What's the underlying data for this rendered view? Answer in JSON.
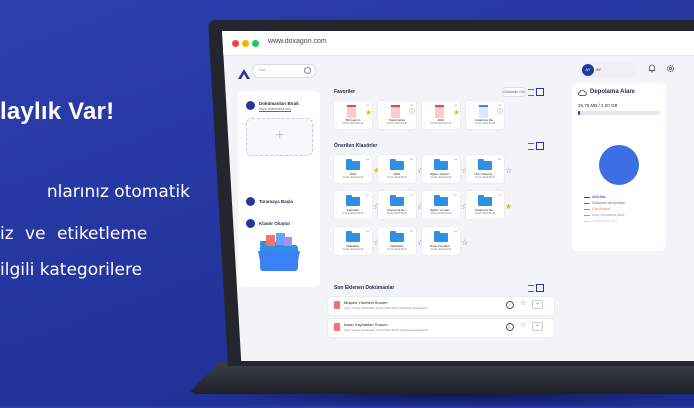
{
  "promo": {
    "title": "laylık Var!",
    "line1": "nlarınız otomatik",
    "line2": "iz ve etiketleme",
    "line3": "ilgili kategorilere"
  },
  "browser": {
    "url": "www.doxagon.com"
  },
  "header": {
    "search_placeholder": "Ara",
    "user_initials": "AY",
    "user_name": "AY"
  },
  "sidebar": {
    "doc_title": "Dokümanları Bırak",
    "doc_sub": "veya dokümana seç",
    "scan_label": "Taramaya Başla",
    "folder_label": "Klasör Oluştur"
  },
  "favorites": {
    "title": "Favoriler",
    "view_label": "Görüntüle Gör",
    "items": [
      {
        "name": "Bill Gurium",
        "date": "01.01.2023 09:32",
        "type": "pdf",
        "fav": true
      },
      {
        "name": "Nişan fatura",
        "date": "01.01.2023 09:32",
        "type": "pdf",
        "fav": false
      },
      {
        "name": "2021",
        "date": "01.01.2023 09:32",
        "type": "pdf",
        "fav": true
      },
      {
        "name": "Araştırma Ra...",
        "date": "01.01.2023 09:32",
        "type": "doc",
        "fav": false
      }
    ]
  },
  "suggested": {
    "title": "Önerilen Klasörler",
    "items": [
      {
        "name": "2021",
        "date": "01.01.2023 09:32",
        "fav": true
      },
      {
        "name": "2020",
        "date": "01.01.2023 09:32",
        "fav": false
      },
      {
        "name": "Eğitim Doküm...",
        "date": "01.01.2023 09:32",
        "fav": false
      },
      {
        "name": "Ürün Tasarım ...",
        "date": "01.01.2023 09:32",
        "fav": false
      },
      {
        "name": "Faturalar",
        "date": "01.01.2023 09:32",
        "fav": false
      },
      {
        "name": "Üzgeçmiş Do...",
        "date": "01.01.2023 09:32",
        "fav": false
      },
      {
        "name": "Eğitim ve Gelı...",
        "date": "01.01.2023 09:32",
        "fav": false
      },
      {
        "name": "Araştırma Ra...",
        "date": "01.01.2023 09:32",
        "fav": true
      },
      {
        "name": "Makaleler",
        "date": "01.01.2023 09:32",
        "fav": false
      },
      {
        "name": "Makaleler",
        "date": "01.01.2023 09:32",
        "fav": false
      },
      {
        "name": "Proje Kaynaklı...",
        "date": "01.01.2023 09:32",
        "fav": false
      }
    ]
  },
  "recent": {
    "title": "Son Eklenen Dokümanlar",
    "items": [
      {
        "name": "Müşteri Yönetimi Sunum",
        "meta": "Ayhn Yılmaz tarafından 01.01.2023 09:32 tarihinde güncellendi"
      },
      {
        "name": "İnsan Kaynakları Sunum",
        "meta": "Ayhn Yılmaz tarafından 01.01.2023 09:32 tarihinde güncellendi"
      }
    ]
  },
  "storage": {
    "title": "Depolama Alanı",
    "usage": "25.75 MB / 2.00 GB",
    "used_fraction": 0.013,
    "legend": [
      {
        "label": "Aktif Alan",
        "color": "#2536a0"
      },
      {
        "label": "Doküman Versiyonları",
        "color": "#64748b"
      },
      {
        "label": "Çöp Kutusu",
        "color": "#f97316"
      },
      {
        "label": "Arşiv Depolama Alanı",
        "color": "#94a3b8"
      },
      {
        "label": "Kullanılabilir Alan",
        "color": "#cbd5e1"
      }
    ]
  },
  "colors": {
    "accent": "#2536a0",
    "folder": "#2e8fe6",
    "star": "#f5b400"
  }
}
